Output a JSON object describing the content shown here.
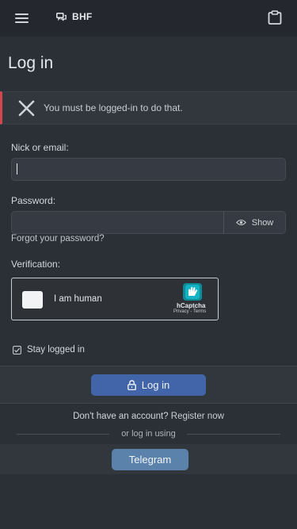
{
  "header": {
    "brand": "BHF",
    "menu_icon": "hamburger-menu-icon",
    "brand_icon": "chat-bubbles-icon",
    "right_icon": "clipboard-icon"
  },
  "page": {
    "title": "Log in"
  },
  "alert": {
    "message": "You must be logged-in to do that.",
    "icon": "close-x-icon",
    "accent_color": "#d2474d"
  },
  "form": {
    "nick_label": "Nick or email:",
    "nick_value": "",
    "password_label": "Password:",
    "password_value": "",
    "show_label": "Show",
    "forgot_label": "Forgot your password?",
    "verification_label": "Verification:",
    "captcha": {
      "checkbox_label": "I am human",
      "brand": "hCaptcha",
      "links": "Privacy - Terms"
    },
    "stay_logged_in_label": "Stay logged in",
    "stay_logged_in_checked": true,
    "submit_label": "Log in",
    "submit_color": "#4165a8"
  },
  "footer": {
    "register_prompt": "Don't have an account?",
    "register_link": "Register now",
    "or_text": "or log in using",
    "telegram_label": "Telegram",
    "telegram_color": "#5b82ab"
  }
}
